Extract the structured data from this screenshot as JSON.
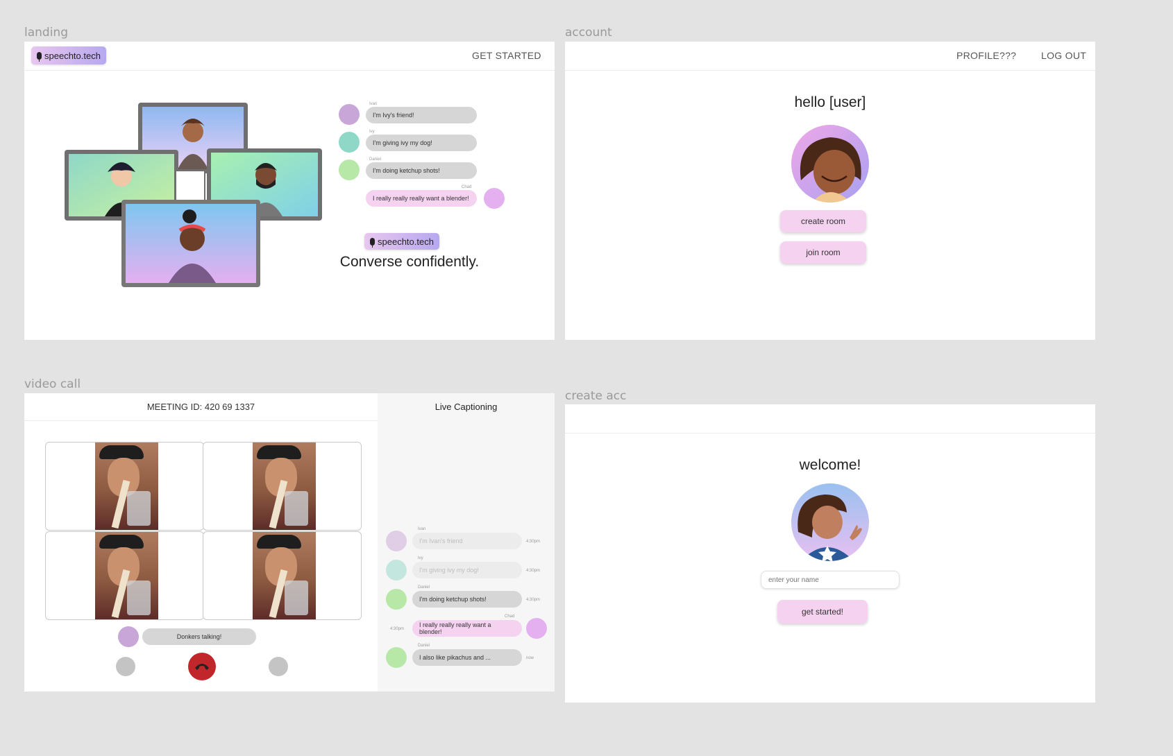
{
  "frames": {
    "landing_label": "landing",
    "account_label": "account",
    "video_call_label": "video call",
    "create_acc_label": "create acc"
  },
  "landing": {
    "logo": "speechto.tech",
    "nav_get_started": "GET STARTED",
    "chat": [
      {
        "name": "Ivan",
        "text": "I'm Ivy's friend!",
        "side": "left"
      },
      {
        "name": "Ivy",
        "text": "I'm giving ivy my dog!",
        "side": "left"
      },
      {
        "name": "Daniel",
        "text": "I'm doing ketchup shots!",
        "side": "left"
      },
      {
        "name": "Chad",
        "text": "I really really really want a blender!",
        "side": "right"
      }
    ],
    "brand_pill": "speechto.tech",
    "tagline": "Converse confidently."
  },
  "account": {
    "nav_profile": "PROFILE???",
    "nav_logout": "LOG OUT",
    "greeting": "hello [user]",
    "create_room": "create room",
    "join_room": "join room"
  },
  "video_call": {
    "meeting_id": "MEETING ID: 420 69 1337",
    "captions_title": "Live Captioning",
    "speaker_status": "Donkers talking!",
    "captions": [
      {
        "name": "Ivan",
        "text": "I'm Ivan's friend",
        "time": "4:30pm",
        "side": "left",
        "faded": true
      },
      {
        "name": "Ivy",
        "text": "I'm giving ivy my dog!",
        "time": "4:30pm",
        "side": "left",
        "faded": true
      },
      {
        "name": "Daniel",
        "text": "I'm doing ketchup shots!",
        "time": "4:30pm",
        "side": "left",
        "faded": false
      },
      {
        "name": "Chad",
        "text": "I really really really want a blender!",
        "time": "4:30pm",
        "side": "right",
        "faded": false
      },
      {
        "name": "Daniel",
        "text": "I also like pikachus and ...",
        "time": "now",
        "side": "left",
        "faded": false
      }
    ]
  },
  "create_acc": {
    "welcome": "welcome!",
    "name_placeholder": "enter your name",
    "get_started": "get started!"
  },
  "colors": {
    "background": "#e3e3e3",
    "pink_button": "#f5d2f0",
    "chat_bubble": "#d6d6d6",
    "own_bubble": "#f5d2f0",
    "end_call": "#c0262a",
    "logo_gradient": [
      "#e8c6ef",
      "#b7a8ef"
    ]
  }
}
